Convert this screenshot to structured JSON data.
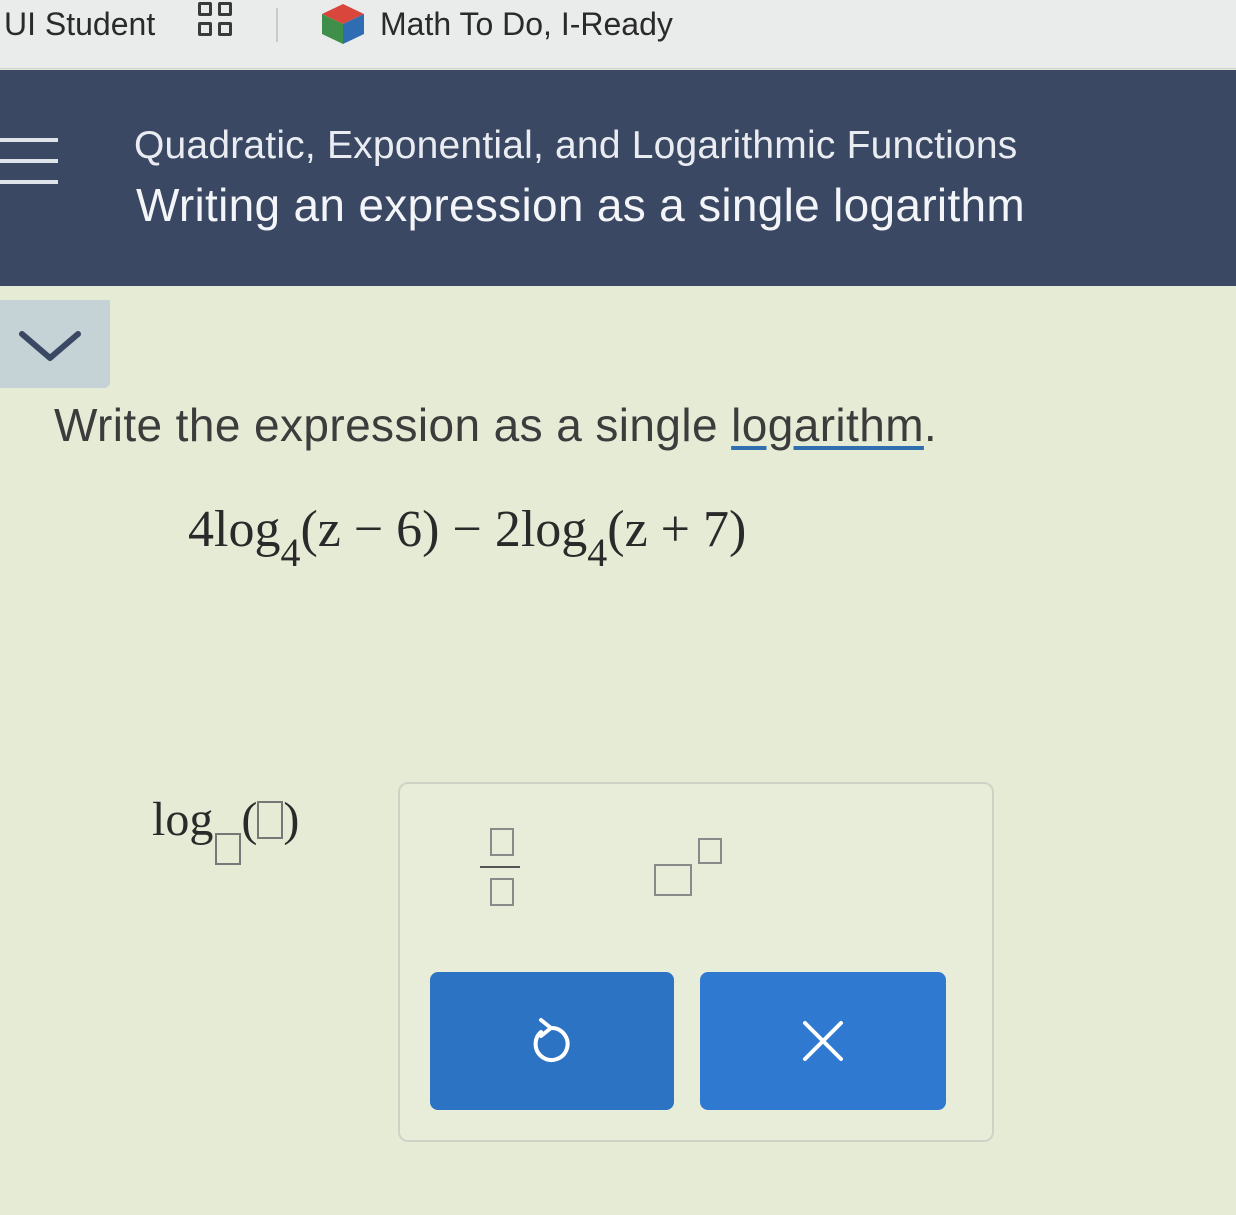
{
  "bookmarks": {
    "items": [
      {
        "label": "UI Student"
      },
      {
        "label": "Math To Do, I-Ready"
      }
    ]
  },
  "header": {
    "topic": "Quadratic, Exponential, and Logarithmic Functions",
    "title": "Writing an expression as a single logarithm"
  },
  "question": {
    "prompt_before": "Write the expression as a single ",
    "prompt_link": "logarithm",
    "prompt_after": ".",
    "expression": {
      "coef1": "4",
      "log1": "log",
      "base1": "4",
      "arg1": "(z − 6)",
      "operator": " − ",
      "coef2": "2",
      "log2": "log",
      "base2": "4",
      "arg2": "(z + 7)"
    }
  },
  "answer": {
    "log_label": "log",
    "open_paren": "(",
    "close_paren": ")"
  },
  "colors": {
    "header_bg": "#3a4863",
    "button_blue": "#2f77c9"
  },
  "icons": {
    "menu": "menu-icon",
    "collapse": "chevron-down-icon",
    "undo": "undo-icon",
    "clear": "close-icon"
  }
}
